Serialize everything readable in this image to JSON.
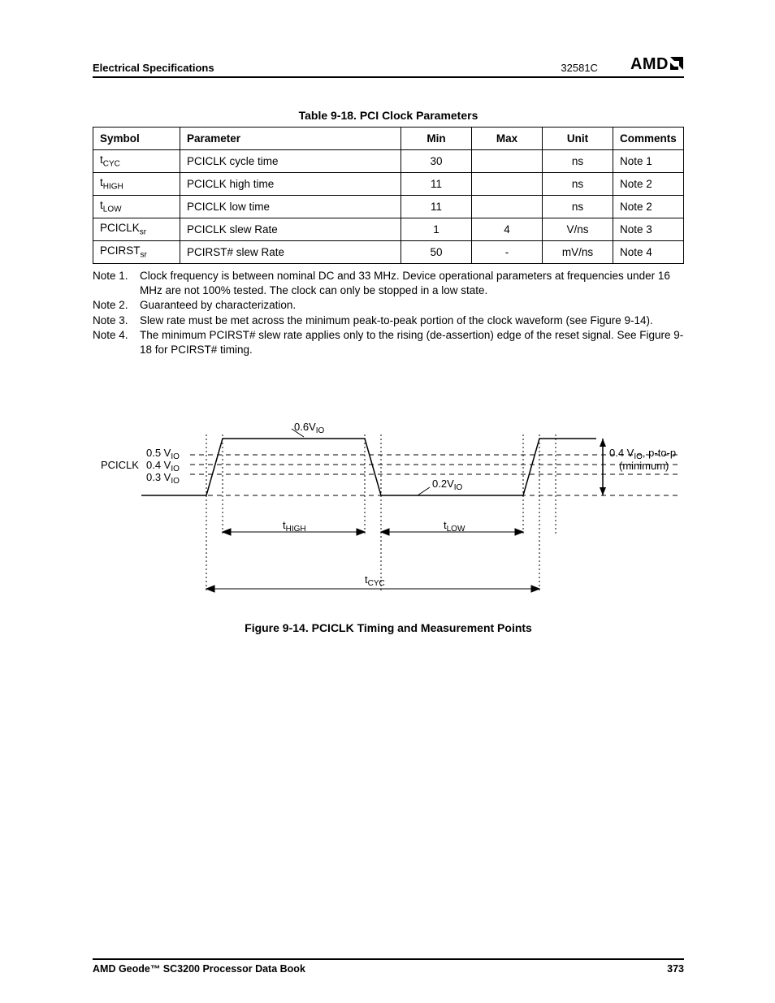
{
  "header": {
    "section": "Electrical Specifications",
    "docnum": "32581C",
    "brand": "AMD"
  },
  "table": {
    "title": "Table 9-18.  PCI Clock Parameters",
    "columns": [
      "Symbol",
      "Parameter",
      "Min",
      "Max",
      "Unit",
      "Comments"
    ],
    "rows": [
      {
        "sym_base": "t",
        "sym_sub": "CYC",
        "param": "PCICLK cycle time",
        "min": "30",
        "max": "",
        "unit": "ns",
        "comments": "Note 1"
      },
      {
        "sym_base": "t",
        "sym_sub": "HIGH",
        "param": "PCICLK high time",
        "min": "11",
        "max": "",
        "unit": "ns",
        "comments": "Note 2"
      },
      {
        "sym_base": "t",
        "sym_sub": "LOW",
        "param": "PCICLK low time",
        "min": "11",
        "max": "",
        "unit": "ns",
        "comments": "Note 2"
      },
      {
        "sym_base": "PCICLK",
        "sym_sub": "sr",
        "param": "PCICLK slew Rate",
        "min": "1",
        "max": "4",
        "unit": "V/ns",
        "comments": "Note 3"
      },
      {
        "sym_base": "PCIRST",
        "sym_sub": "sr",
        "param": "PCIRST# slew Rate",
        "min": "50",
        "max": "-",
        "unit": "mV/ns",
        "comments": "Note 4"
      }
    ]
  },
  "notes": [
    {
      "label": "Note 1.",
      "text": "Clock frequency is between nominal DC and 33 MHz. Device operational parameters at frequencies under 16 MHz are not 100% tested. The clock can only be stopped in a low state."
    },
    {
      "label": "Note 2.",
      "text": "Guaranteed by characterization."
    },
    {
      "label": "Note 3.",
      "text": "Slew rate must be met across the minimum peak-to-peak portion of the clock waveform (see Figure 9-14)."
    },
    {
      "label": "Note 4.",
      "text": "The minimum PCIRST# slew rate applies only to the rising (de-assertion) edge of the reset signal. See Figure 9-18 for PCIRST# timing."
    }
  ],
  "figure": {
    "caption": "Figure 9-14.  PCICLK Timing and Measurement Points",
    "labels": {
      "pciclk": "PCICLK",
      "v05": "0.5 V",
      "v04": "0.4 V",
      "v03": "0.3 V",
      "vio_sub": "IO",
      "v06top": "0.6V",
      "v02bot": "0.2V",
      "ptop_a": "0.4 V",
      "ptop_b": ", p-to-p",
      "ptop_c": "(minimum)",
      "thigh": "t",
      "thigh_sub": "HIGH",
      "tlow": "t",
      "tlow_sub": "LOW",
      "tcyc": "t",
      "tcyc_sub": "CYC"
    }
  },
  "footer": {
    "left": "AMD Geode™ SC3200 Processor Data Book",
    "right": "373"
  }
}
